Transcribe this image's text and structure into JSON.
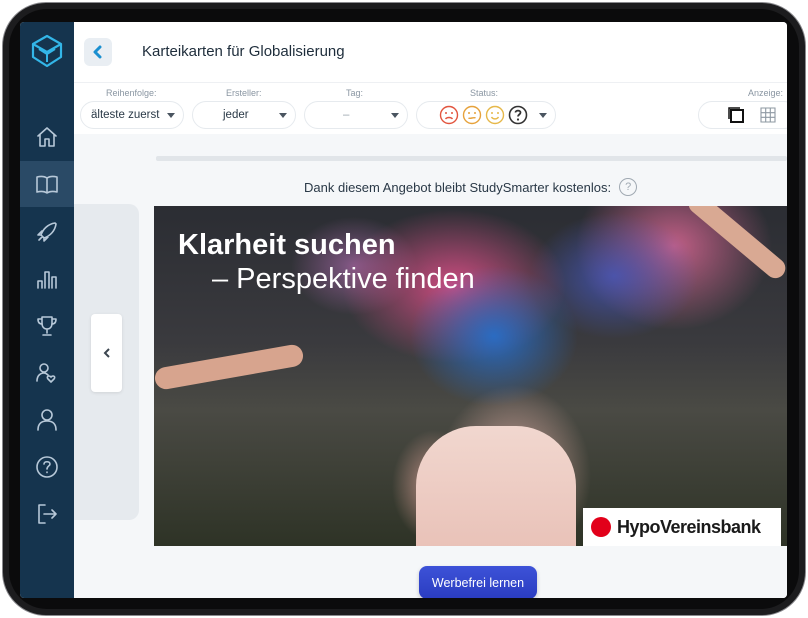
{
  "header": {
    "title": "Karteikarten für Globalisierung"
  },
  "filters": {
    "order": {
      "label": "Reihenfolge:",
      "value": "älteste zuerst"
    },
    "creator": {
      "label": "Ersteller:",
      "value": "jeder"
    },
    "tag": {
      "label": "Tag:",
      "value": "–"
    },
    "status": {
      "label": "Status:",
      "icons": [
        "sad-face-icon",
        "neutral-face-icon",
        "happy-face-icon",
        "question-icon"
      ]
    },
    "view": {
      "label": "Anzeige:",
      "icons": [
        "single-card-icon",
        "grid-icon"
      ]
    }
  },
  "sidebar": {
    "items": [
      "home-icon",
      "book-icon",
      "rocket-icon",
      "chart-icon",
      "trophy-icon",
      "friends-icon",
      "profile-icon",
      "help-icon",
      "logout-icon"
    ],
    "active_index": 1
  },
  "ad": {
    "notice": "Dank diesem Angebot bleibt StudySmarter kostenlos:",
    "help_glyph": "?",
    "headline_1": "Klarheit suchen",
    "headline_2": "– Perspektive finden",
    "brand": "HypoVereinsbank",
    "cta": "Werbefrei lernen"
  },
  "colors": {
    "sidebar": "#15344e",
    "accent": "#1a8fd0",
    "cta": "#2f42c8",
    "brand_red": "#e2001a"
  }
}
